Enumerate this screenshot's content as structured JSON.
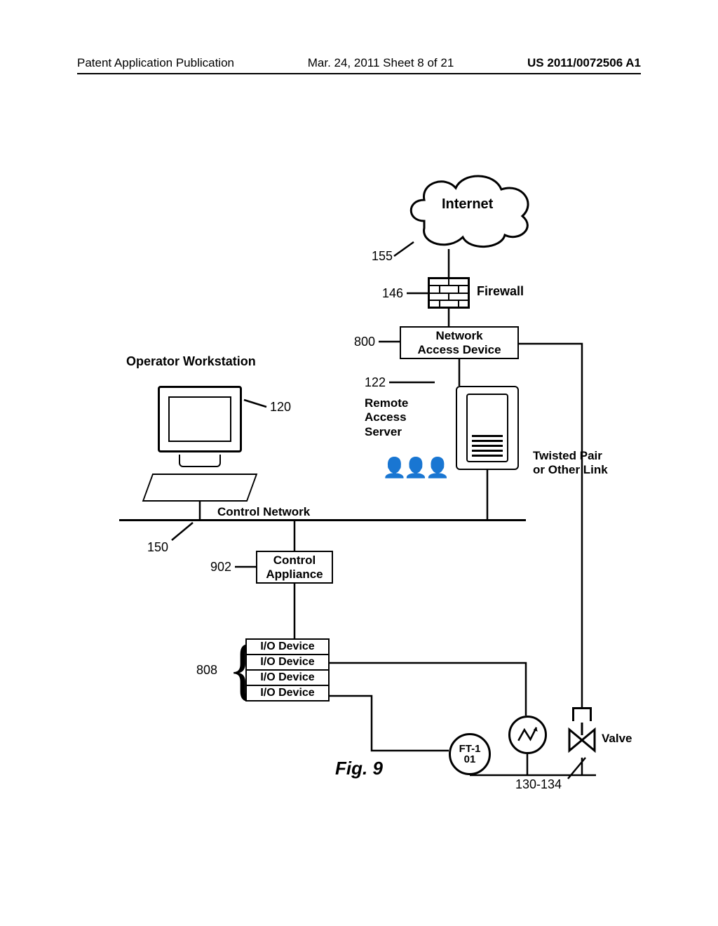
{
  "header": {
    "left": "Patent Application Publication",
    "mid": "Mar. 24, 2011  Sheet 8 of 21",
    "right": "US 2011/0072506 A1"
  },
  "labels": {
    "internet": "Internet",
    "firewall": "Firewall",
    "nad": "Network\nAccess Device",
    "ras": "Remote\nAccess\nServer",
    "operator_ws": "Operator Workstation",
    "control_network": "Control Network",
    "control_appliance": "Control\nAppliance",
    "io_device": "I/O Device",
    "twisted_pair": "Twisted Pair\nor Other Link",
    "valve": "Valve",
    "ft_top": "FT-1",
    "ft_bot": "01"
  },
  "refs": {
    "internet": "155",
    "firewall": "146",
    "nad": "800",
    "ras": "122",
    "workstation": "120",
    "bus": "150",
    "control_appliance": "902",
    "io_group": "808",
    "field_devices": "130-134"
  },
  "figure_caption": "Fig. 9"
}
